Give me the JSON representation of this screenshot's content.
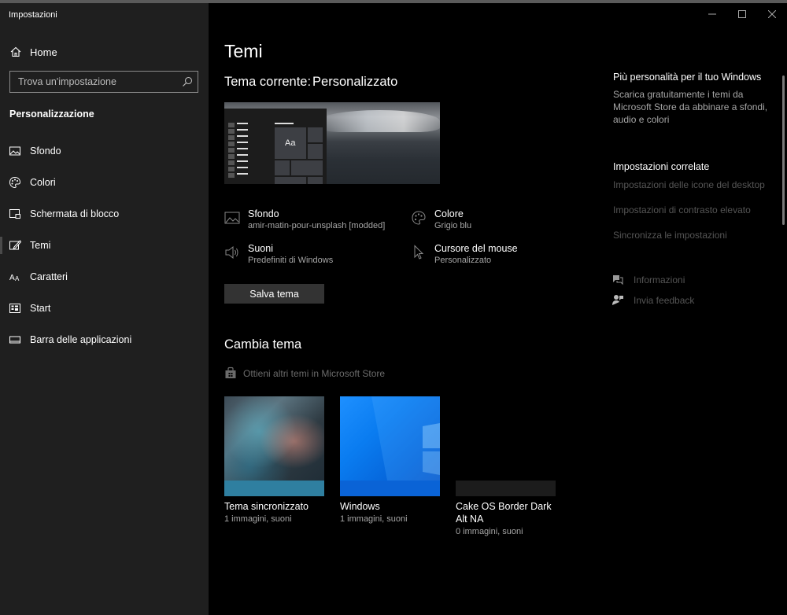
{
  "window": {
    "app_title": "Impostazioni"
  },
  "sidebar": {
    "home_label": "Home",
    "search_placeholder": "Trova un'impostazione",
    "section_title": "Personalizzazione",
    "items": [
      {
        "label": "Sfondo",
        "icon": "picture-icon"
      },
      {
        "label": "Colori",
        "icon": "palette-icon"
      },
      {
        "label": "Schermata di blocco",
        "icon": "lock-screen-icon"
      },
      {
        "label": "Temi",
        "icon": "brush-icon",
        "active": true
      },
      {
        "label": "Caratteri",
        "icon": "font-icon"
      },
      {
        "label": "Start",
        "icon": "start-icon"
      },
      {
        "label": "Barra delle applicazioni",
        "icon": "taskbar-icon"
      }
    ]
  },
  "main": {
    "page_title": "Temi",
    "current_theme_label": "Tema corrente:",
    "current_theme_value": "Personalizzato",
    "preview_tile_text": "Aa",
    "props": {
      "background": {
        "name": "Sfondo",
        "value": "amir-matin-pour-unsplash [modded]"
      },
      "color": {
        "name": "Colore",
        "value": "Grigio blu"
      },
      "sounds": {
        "name": "Suoni",
        "value": "Predefiniti di Windows"
      },
      "cursor": {
        "name": "Cursore del mouse",
        "value": "Personalizzato"
      }
    },
    "save_button": "Salva tema",
    "change_title": "Cambia tema",
    "store_link": "Ottieni altri temi in Microsoft Store",
    "themes": [
      {
        "name": "Tema sincronizzato",
        "sub": "1 immagini, suoni"
      },
      {
        "name": "Windows",
        "sub": "1 immagini, suoni"
      },
      {
        "name": "Cake OS Border Dark Alt NA",
        "sub": "0 immagini, suoni"
      }
    ]
  },
  "right": {
    "promo_title": "Più personalità per il tuo Windows",
    "promo_text": "Scarica gratuitamente i temi da Microsoft Store da abbinare a sfondi, audio e colori",
    "related_title": "Impostazioni correlate",
    "related_links": [
      "Impostazioni delle icone del desktop",
      "Impostazioni di contrasto elevato",
      "Sincronizza le impostazioni"
    ],
    "help_info": "Informazioni",
    "help_feedback": "Invia feedback"
  },
  "colors": {
    "background": "#000000",
    "sidebar": "#1f1f1f",
    "button": "#333333",
    "windows_blue": "#0a7cf0"
  }
}
